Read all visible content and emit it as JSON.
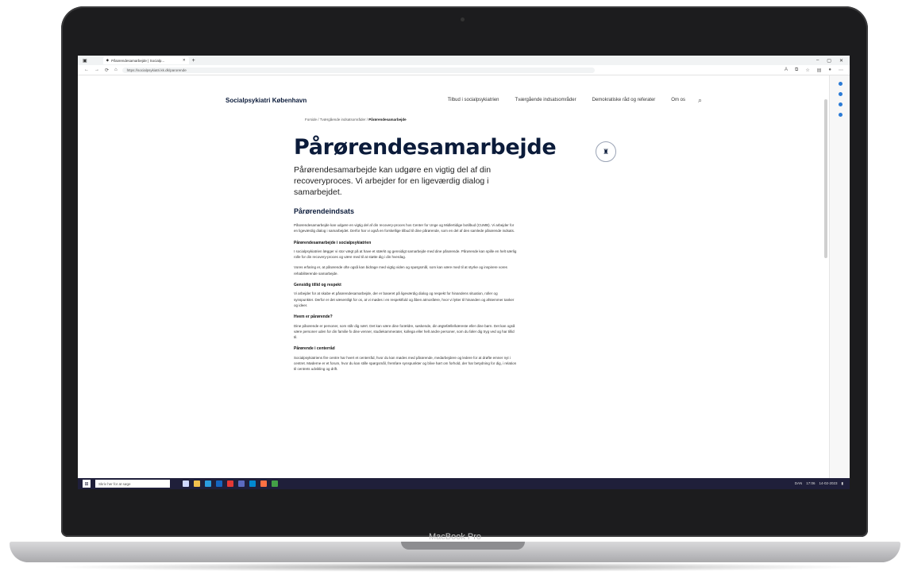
{
  "device": {
    "label": "MacBook Pro"
  },
  "browser": {
    "tab_title": "Pårørendesamarbejde | Socialp...",
    "url": "https://socialpsykiatri.kk.dk/parorende",
    "nav": {
      "back": "←",
      "forward": "→",
      "refresh": "⟳",
      "home": "⌂"
    },
    "window": {
      "min": "–",
      "max": "▢",
      "close": "✕"
    }
  },
  "site": {
    "logo": "Socialpsykiatri København",
    "nav": [
      "Tilbud i socialpsykiatrien",
      "Tværgående indsatsområder",
      "Demokratiske råd og referater",
      "Om os"
    ]
  },
  "breadcrumb": {
    "home": "Forside",
    "section": "Tværgående indsatsområder",
    "current": "Pårørendesamarbejde",
    "sep": "/"
  },
  "page": {
    "title": "Pårørendesamarbejde",
    "lead": "Pårørendesamarbejde kan udgøre en vigtig del af din recoveryproces. Vi arbejder for en ligeværdig dialog i samarbejdet.",
    "section_title": "Pårørendeindsats",
    "intro": "Pårørendesamarbejde kan udgøre en vigtig del af din recovery-proces hos Center for Unge og Midlertidige botilbud (CUMB). Vi arbejder for en ligeværdig dialog i samarbejdet. Derfor har vi også en forskellige tilbud til dine pårørende, som en del af den samlede pårørende indsats.",
    "s1_title": "Pårørendesamarbejde i socialpsykiatrien",
    "s1_p1": "I socialpsykiatrien lægger vi stor vægt på at have et stærkt og gensidigt samarbejde med dine pårørende. Pårørende kan spille en helt særlig rolle for din recovery-proces og være med til at støtte dig i din hverdag.",
    "s1_p2": "Vores erfaring er, at pårørende ofte også kan bidrage med vigtig viden og spørgsmål, som kan være med til at styrke og inspirere vores rehabiliterende samarbejde.",
    "s2_title": "Gensidig tillid og respekt",
    "s2_p1": "Vi arbejder for at skabe et pårørendesamarbejde, der er baseret på ligeværdig dialog og respekt for hinandens situation, roller og synspunkter. Derfor er det væsentligt for os, at vi mødes i en respektfuld og åben atmosfære, hvor vi lytter til hinanden og afstemmer tanker og ideer.",
    "s3_title": "Hvem er pårørende?",
    "s3_p1": "Dine pårørende er personer, som står dig nært. Det kan være dine forældre, søskende, din ægtefælle/kæreste eller dine børn. Det kan også være personer uden for din familie fx dine venner, studiekammerater, kollega eller helt andre personer, som du føler dig tryg ved og har tillid til.",
    "s4_title": "Pårørende i centerråd",
    "s4_p1": "Socialpsykiatriens fire centre har hvert et centerråd, hvor du kan mødes med pårørende, medarbejdere og ledere for at drøfte emner nyt i centret. Møderne er et forum, hvor du kan stille spørgsmål, fremføre synspunkter og blive hørt om forhold, der har betydning for dig, i relation til centrets udvikling og drift."
  },
  "taskbar": {
    "search_placeholder": "Skriv her for at søge",
    "time": "17:06",
    "date": "14-02-2023",
    "lang": "DAN"
  }
}
